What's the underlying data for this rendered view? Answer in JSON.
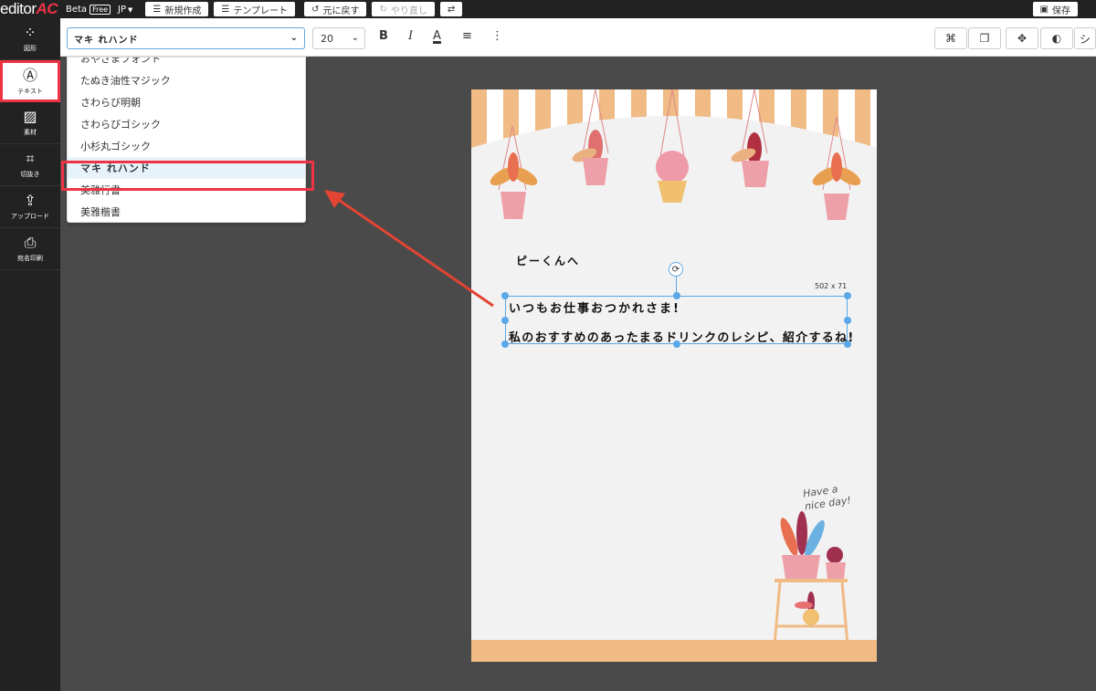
{
  "topbar": {
    "logo_text": "editor",
    "logo_accent": "AC",
    "beta": "Beta",
    "free": "Free",
    "lang": "JP",
    "new": "新規作成",
    "template": "テンプレート",
    "undo": "元に戻す",
    "redo": "やり直し",
    "save": "保存"
  },
  "sidebar": {
    "items": [
      {
        "label": "図形",
        "icon": "shapes-icon"
      },
      {
        "label": "テキスト",
        "icon": "text-icon"
      },
      {
        "label": "素材",
        "icon": "image-icon"
      },
      {
        "label": "切抜き",
        "icon": "crop-icon"
      },
      {
        "label": "アップロード",
        "icon": "upload-icon"
      },
      {
        "label": "宛名印刷",
        "icon": "print-icon"
      }
    ]
  },
  "toolbar": {
    "font_value": "マキ れハンド",
    "size_value": "20"
  },
  "font_dropdown": {
    "options": [
      "おやさまフォント",
      "たぬき油性マジック",
      "さわらび明朝",
      "さわらびゴシック",
      "小杉丸ゴシック",
      "マキ れハンド",
      "美雅行書",
      "美雅楷書"
    ],
    "selected": "マキ れハンド"
  },
  "canvas": {
    "greeting": "ピーくんへ",
    "line1": "いつもお仕事おつかれさま!",
    "line2": "私のおすすめのあったまるドリンクのレシピ、紹介するね!",
    "dims": "502 x 71",
    "have_a": "Have a",
    "nice_day": "nice day!"
  },
  "colors": {
    "accent_red": "#e34433",
    "selection_blue": "#5aa8e8",
    "stripe_orange": "#f0bb85"
  }
}
